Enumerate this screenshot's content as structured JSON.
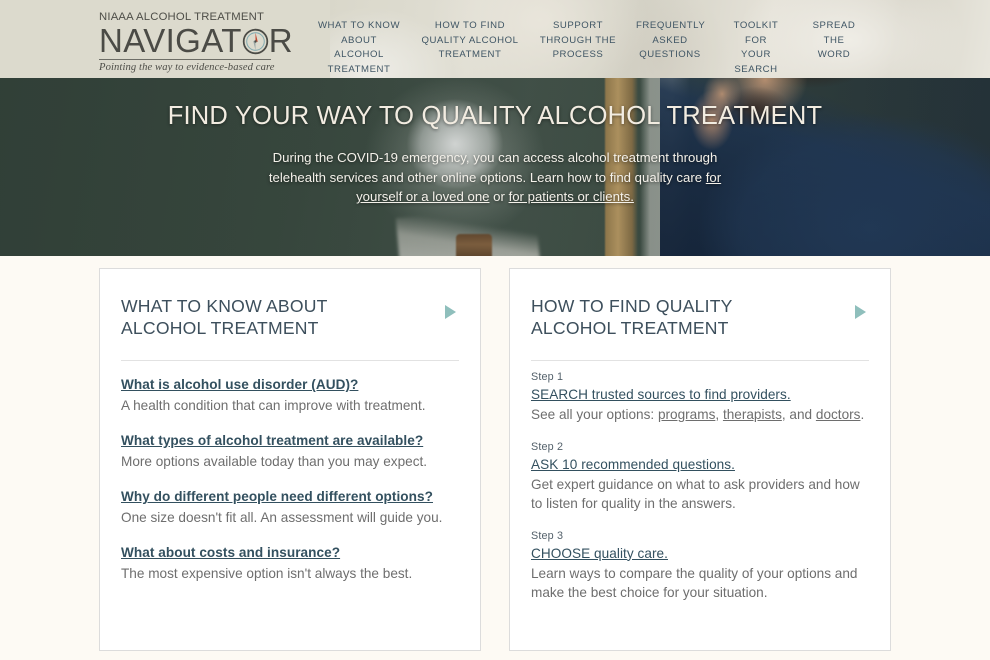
{
  "header": {
    "logo": {
      "top_line": "NIAAA ALCOHOL TREATMENT",
      "word_left": "NAVIGAT",
      "word_right": "R",
      "tagline": "Pointing the way to evidence-based care",
      "compass_icon": "compass-icon"
    },
    "nav": [
      {
        "label": "WHAT TO KNOW\nABOUT ALCOHOL\nTREATMENT",
        "name": "nav-what-to-know"
      },
      {
        "label": "HOW TO FIND\nQUALITY ALCOHOL\nTREATMENT",
        "name": "nav-how-to-find"
      },
      {
        "label": "SUPPORT\nTHROUGH THE\nPROCESS",
        "name": "nav-support"
      },
      {
        "label": "FREQUENTLY\nASKED\nQUESTIONS",
        "name": "nav-faq"
      },
      {
        "label": "TOOLKIT FOR\nYOUR\nSEARCH",
        "name": "nav-toolkit"
      },
      {
        "label": "SPREAD\nTHE\nWORD",
        "name": "nav-spread-the-word"
      }
    ]
  },
  "hero": {
    "title": "FIND YOUR WAY TO QUALITY ALCOHOL TREATMENT",
    "body_part1": "During the COVID-19 emergency, you can access alcohol treatment through telehealth services and other online options. Learn how to find quality care ",
    "link_self": "for yourself or a loved one",
    "body_conjunction": " or ",
    "link_clients": "for patients or clients.",
    "background_color": "#3b4a41"
  },
  "cards": [
    {
      "title": "WHAT TO KNOW ABOUT ALCOHOL TREATMENT",
      "arrow_icon": "play-arrow-icon",
      "items": [
        {
          "link": "What is alcohol use disorder (AUD)?",
          "desc": "A health condition that can improve with treatment."
        },
        {
          "link": "What types of alcohol treatment are available?",
          "desc": "More options available today than you may expect."
        },
        {
          "link": "Why do different people need different options?",
          "desc": "One size doesn't fit all. An assessment will guide you."
        },
        {
          "link": "What about costs and insurance?",
          "desc": "The most expensive option isn't always the best."
        }
      ]
    },
    {
      "title": "HOW TO FIND QUALITY ALCOHOL TREATMENT",
      "arrow_icon": "play-arrow-icon",
      "steps": [
        {
          "label": "Step 1",
          "link": "SEARCH trusted sources to find providers.",
          "desc_lead": "See all your options: ",
          "link_programs": "programs",
          "desc_sep1": ", ",
          "link_therapists": "therapists",
          "desc_sep2": ", and ",
          "link_doctors": "doctors",
          "desc_end": "."
        },
        {
          "label": "Step 2",
          "link": "ASK 10 recommended questions.",
          "desc": "Get expert guidance on what to ask providers and how to listen for quality in the answers."
        },
        {
          "label": "Step 3",
          "link": "CHOOSE quality care.",
          "desc": "Learn ways to compare the quality of your options and make the best choice for your situation."
        }
      ]
    }
  ],
  "colors": {
    "header_bg": "#dcdacd",
    "hero_bg": "#3b4a41",
    "page_bg": "#fdfaf4",
    "accent_teal": "#8fbfbc",
    "link_blue": "#33505f"
  }
}
